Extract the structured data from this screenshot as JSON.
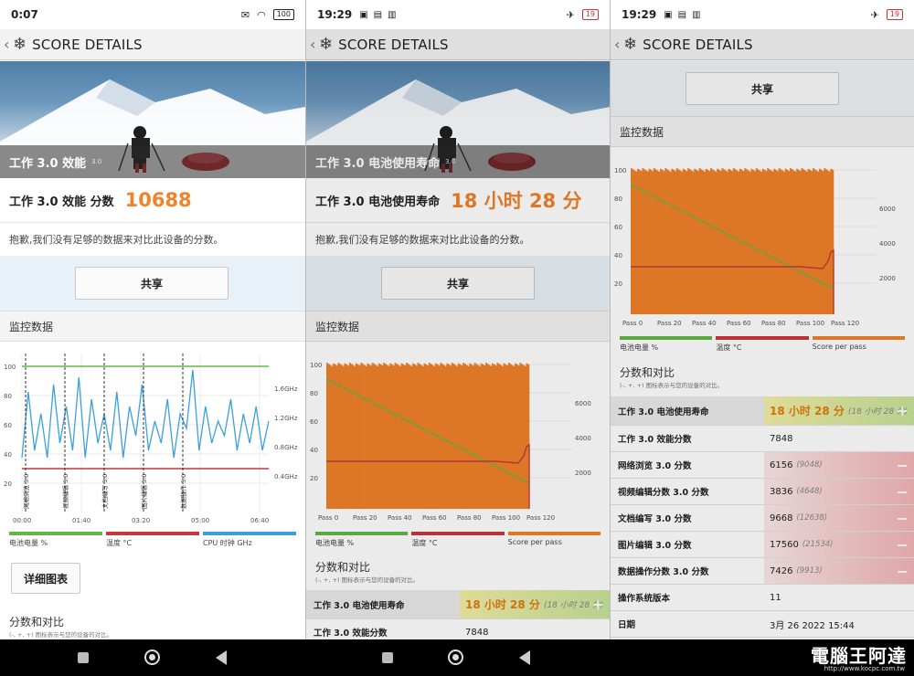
{
  "panel1": {
    "status": {
      "time": "0:07",
      "battery": "100"
    },
    "appbar_title": "SCORE DETAILS",
    "hero_caption": "工作 3.0 效能",
    "hero_version": "3.0",
    "score_label": "工作 3.0 效能 分数",
    "score_value": "10688",
    "note": "抱歉,我们没有足够的数据来对比此设备的分数。",
    "share_label": "共享",
    "monitor_title": "监控数据",
    "detail_label": "详细图表",
    "compare_title": "分数和对比",
    "compare_sub": "(-, +, +) 图标表示与您的设备的对比。",
    "legend": [
      {
        "label": "电池电量 %",
        "color": "#62b846"
      },
      {
        "label": "温度 °C",
        "color": "#c8373b"
      },
      {
        "label": "CPU 时钟 GHz",
        "color": "#3aa1dc"
      }
    ]
  },
  "panel2": {
    "status": {
      "time": "19:29",
      "battery": "19"
    },
    "appbar_title": "SCORE DETAILS",
    "hero_caption": "工作 3.0 电池使用寿命",
    "hero_version": "3.0",
    "score_label": "工作 3.0 电池使用寿命",
    "score_value": "18 小时 28 分",
    "note": "抱歉,我们没有足够的数据来对比此设备的分数。",
    "share_label": "共享",
    "monitor_title": "监控数据",
    "compare_title": "分数和对比",
    "compare_sub": "(-, +, +) 图标表示与您的设备的对比。",
    "legend": [
      {
        "label": "电池电量 %",
        "color": "#62b846"
      },
      {
        "label": "温度 °C",
        "color": "#c8373b"
      },
      {
        "label": "Score per pass",
        "color": "#f0822a"
      }
    ],
    "rows": [
      {
        "label": "工作 3.0 电池使用寿命",
        "value": "18 小时 28 分",
        "paren": "(18 小时 28 分)",
        "style": "green",
        "sign": "+"
      },
      {
        "label": "工作 3.0 效能分数",
        "value": "7848",
        "paren": "",
        "style": "",
        "sign": ""
      }
    ]
  },
  "panel3": {
    "status": {
      "time": "19:29",
      "battery": "19"
    },
    "appbar_title": "SCORE DETAILS",
    "share_label": "共享",
    "monitor_title": "监控数据",
    "compare_title": "分数和对比",
    "compare_sub": "(-, +, +) 图标表示与您的设备的对比。",
    "legend": [
      {
        "label": "电池电量 %",
        "color": "#62b846"
      },
      {
        "label": "温度 °C",
        "color": "#c8373b"
      },
      {
        "label": "Score per pass",
        "color": "#f0822a"
      }
    ],
    "rows": [
      {
        "label": "工作 3.0 电池使用寿命",
        "value": "18 小时 28 分",
        "paren": "(18 小时 28 分)",
        "style": "green",
        "sign": "+"
      },
      {
        "label": "工作 3.0 效能分数",
        "value": "7848",
        "paren": "",
        "style": "",
        "sign": ""
      },
      {
        "label": "网络浏览 3.0 分数",
        "value": "6156",
        "paren": "(9048)",
        "style": "red",
        "sign": "−"
      },
      {
        "label": "视频编辑分数 3.0 分数",
        "value": "3836",
        "paren": "(4648)",
        "style": "red",
        "sign": "−"
      },
      {
        "label": "文档编写 3.0 分数",
        "value": "9668",
        "paren": "(12638)",
        "style": "red",
        "sign": "−"
      },
      {
        "label": "图片编辑 3.0 分数",
        "value": "17560",
        "paren": "(21534)",
        "style": "red",
        "sign": "−"
      },
      {
        "label": "数据操作分数 3.0 分数",
        "value": "7426",
        "paren": "(9913)",
        "style": "red",
        "sign": "−"
      },
      {
        "label": "操作系统版本",
        "value": "11",
        "paren": "",
        "style": "",
        "sign": ""
      },
      {
        "label": "日期",
        "value": "3月 26 2022 15:44",
        "paren": "",
        "style": "",
        "sign": ""
      }
    ]
  },
  "watermark": {
    "text": "電腦王阿達",
    "url": "http://www.kocpc.com.tw"
  },
  "chart_data": [
    {
      "type": "line",
      "y_left_ticks": [
        "100",
        "80",
        "60",
        "40",
        "20"
      ],
      "y_right_ticks": [
        "1.6GHz",
        "1.2GHz",
        "0.8GHz",
        "0.4GHz"
      ],
      "x_ticks": [
        "00:00",
        "01:40",
        "03:20",
        "05:00",
        "06:40"
      ],
      "ylim": [
        0,
        100
      ],
      "markers": [
        "网络浏览 3.0",
        "视频编辑 3.0",
        "文档编写 3.0",
        "图片编辑 3.0",
        "数据操作 3.0"
      ],
      "series": [
        {
          "name": "电池电量 %",
          "values": [
            100,
            100,
            100,
            100,
            100,
            100,
            100,
            100,
            100,
            100,
            100
          ]
        },
        {
          "name": "温度 °C",
          "values": [
            30,
            30,
            30,
            30,
            30,
            30,
            30,
            30,
            30,
            30,
            30
          ]
        },
        {
          "name": "CPU 时钟 GHz",
          "values": [
            0.5,
            1.4,
            0.6,
            1.1,
            0.5,
            1.5,
            0.7,
            1.2,
            0.6,
            1.6,
            0.5,
            1.3,
            0.7,
            1.1,
            0.6,
            1.4,
            0.5,
            1.2,
            0.8,
            1.5,
            0.6,
            1.0,
            0.7,
            1.3,
            0.5,
            1.1,
            0.9,
            1.7,
            0.6,
            1.2,
            0.7,
            1.0,
            0.8,
            1.3,
            0.6,
            1.1,
            0.7,
            1.2,
            0.6,
            1.0
          ]
        }
      ]
    },
    {
      "type": "bar",
      "x_ticks": [
        "Pass 0",
        "Pass 20",
        "Pass 40",
        "Pass 60",
        "Pass 80",
        "Pass 100",
        "Pass 120"
      ],
      "y_left_ticks": [
        "100",
        "80",
        "60",
        "40",
        "20"
      ],
      "y_right_ticks": [
        "6000",
        "4000",
        "2000"
      ],
      "battery_start": 88,
      "battery_end": 10,
      "temperature": 30,
      "passes": 125,
      "score_per_pass": 7000
    }
  ]
}
